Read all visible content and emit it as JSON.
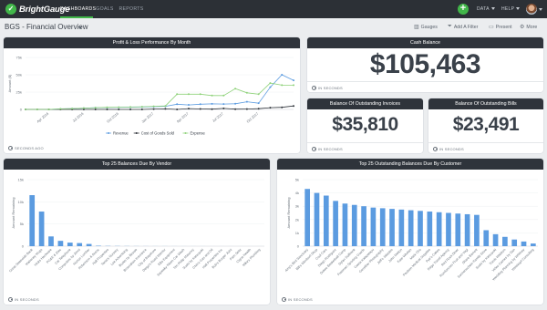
{
  "brand": {
    "name": "BrightGauge"
  },
  "nav": {
    "tabs": [
      {
        "label": "DASHBOARDS",
        "active": true
      },
      {
        "label": "GOALS",
        "active": false
      },
      {
        "label": "REPORTS",
        "active": false
      }
    ],
    "data_menu": "DATA",
    "help_menu": "HELP"
  },
  "dashboard": {
    "title": "BGS - Financial Overview",
    "toolbar": {
      "gauges": "Gauges",
      "add_filter": "Add A Filter",
      "present": "Present",
      "more": "More"
    }
  },
  "widgets": {
    "pl": {
      "title": "Profit & Loss Performance By Month",
      "footer": "SECONDS AGO",
      "chart_data": {
        "type": "line",
        "ylabel": "Amount ($)",
        "yticks": [
          "75k",
          "50k",
          "25k",
          "0"
        ],
        "ylim": [
          0,
          75000
        ],
        "xtick_labels": [
          "Apr 2016",
          "Jul 2016",
          "Oct 2016",
          "Jan 2017",
          "Apr 2017",
          "Jul 2017",
          "Oct 2017"
        ],
        "xtick_positions": [
          2,
          5,
          8,
          11,
          14,
          17,
          20
        ],
        "n_points": 24,
        "series": [
          {
            "name": "Revenue",
            "color": "#5b9be0",
            "values": [
              0,
              0,
              0,
              800,
              1200,
              1800,
              2400,
              2800,
              3000,
              3200,
              3500,
              4000,
              4500,
              7500,
              6500,
              7500,
              8000,
              7800,
              8200,
              11000,
              9000,
              32000,
              50000,
              42000
            ]
          },
          {
            "name": "Cost of Goods Sold",
            "color": "#2f343b",
            "values": [
              0,
              0,
              0,
              0,
              0,
              0,
              0,
              0,
              0,
              0,
              0,
              500,
              800,
              0,
              1200,
              600,
              400,
              1500,
              400,
              500,
              1000,
              2500,
              3000,
              5000
            ]
          },
          {
            "name": "Expense",
            "color": "#8fd27a",
            "values": [
              0,
              0,
              0,
              800,
              1200,
              1800,
              2500,
              3000,
              3200,
              3400,
              3800,
              4500,
              5000,
              22000,
              22000,
              22000,
              20000,
              20000,
              30000,
              24000,
              22000,
              38000,
              35000,
              35000
            ]
          }
        ]
      }
    },
    "cash": {
      "title": "Cash Balance",
      "value": "$105,463",
      "footer": "IN SECONDS"
    },
    "invoices": {
      "title": "Balance Of Outstanding Invoices",
      "value": "$35,810",
      "footer": "IN SECONDS"
    },
    "bills": {
      "title": "Balance Of Outstanding Bills",
      "value": "$23,491",
      "footer": "IN SECONDS"
    },
    "vendor": {
      "title": "Top 25 Balances Due By Vendor",
      "footer": "IN SECONDS",
      "chart_data": {
        "type": "bar",
        "ylabel": "Amount Remaining",
        "yticks": [
          "15k",
          "10k",
          "5k",
          "0"
        ],
        "ylim": [
          0,
          15000
        ],
        "color": "#5b9be0",
        "categories": [
          "Great Statewide Bank",
          "Mahoney Mugs",
          "Hicks Hardware",
          "PG&E & Elec",
          "Cal Telephone",
          "Computers by Jenni",
          "Norton Lumber",
          "Robertson & Assoc",
          "Hall Properties",
          "Tania's Nursery",
          "Lee Advertising",
          "Books by Bessie",
          "Brosnahan Insurance",
          "City of Bayshore",
          "Diego's Road Warrior",
          "Ellis Equipment",
          "Squeaky Kleen Car Wash",
          "Tim Philip Masonry",
          "Sushi by Katsuyuki",
          "Chin's Gas and Oil",
          "Hall Properties Inc",
          "Bob's Burger Joint",
          "Pam Seitz",
          "Cigna Health",
          "Mike's Plumbing"
        ],
        "values": [
          11500,
          7800,
          2200,
          1200,
          800,
          700,
          500,
          100,
          50,
          40,
          30,
          20,
          15,
          10,
          10,
          8,
          5,
          5,
          4,
          3,
          2,
          2,
          1,
          1,
          1
        ]
      }
    },
    "customer": {
      "title": "Top 25 Outstanding Balances Due By Customer",
      "footer": "IN SECONDS",
      "chart_data": {
        "type": "bar",
        "ylabel": "Amount Remaining",
        "yticks": [
          "5k",
          "4k",
          "3k",
          "2k",
          "1k",
          "0"
        ],
        "ylim": [
          0,
          5000
        ],
        "color": "#5b9be0",
        "categories": [
          "Amy's Bird Sanctuary",
          "Bill's Windsurf Shop",
          "Cool Cars",
          "Diego Rodriguez",
          "Dukes Basketball Camp",
          "Dylan Sollfrank",
          "Freeman Sporting Goods",
          "Geeta Kalapatapu",
          "Gevelber Photography",
          "Jeff's Jalopies",
          "John Melton",
          "Kate Whelan",
          "Mark Cho",
          "Paulsen Medical Supplies",
          "Pye's Cakes",
          "Rago Travel Agency",
          "Red Rock Diner",
          "Rondonuwu Fruit and Vegi",
          "Shara Barnett",
          "Sonnenschein Family Store",
          "Sushi by Katsuyuki",
          "Travis Waldron",
          "Video Games by Dan",
          "Wedding Planning by Whitney",
          "Weiskopf Consulting"
        ],
        "values": [
          4300,
          4000,
          3800,
          3400,
          3200,
          3100,
          3000,
          2900,
          2850,
          2800,
          2750,
          2700,
          2650,
          2600,
          2550,
          2500,
          2450,
          2400,
          2350,
          1200,
          900,
          700,
          500,
          350,
          200
        ]
      }
    }
  }
}
